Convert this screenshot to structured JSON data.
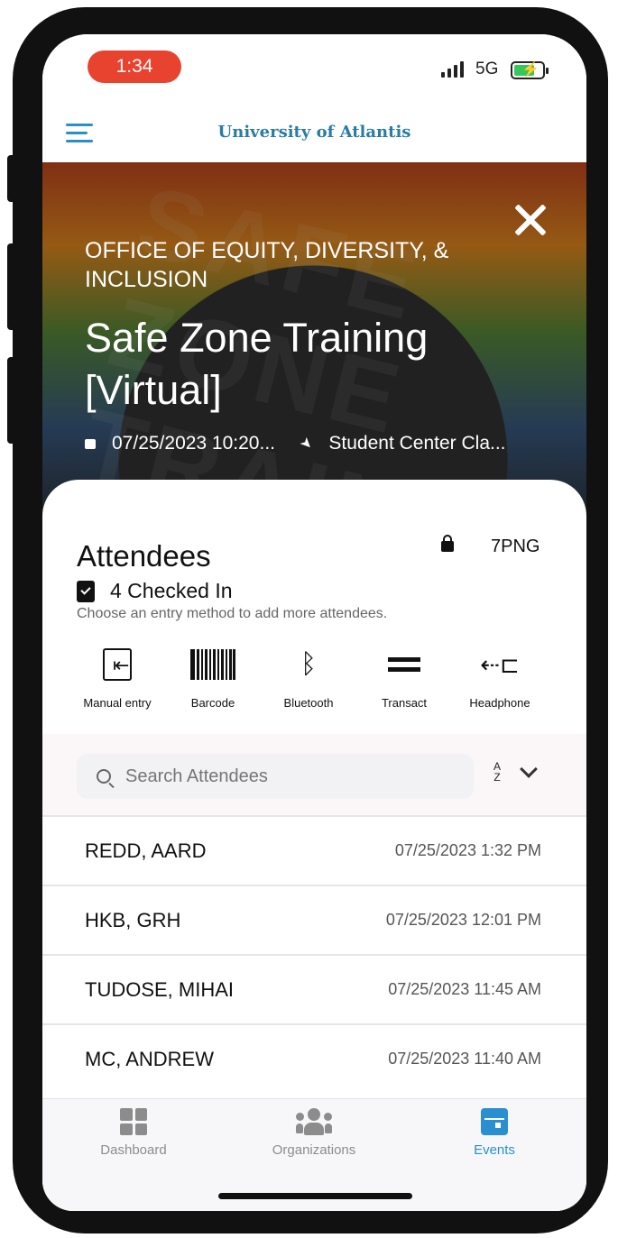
{
  "status_bar": {
    "time": "1:34",
    "network": "5G"
  },
  "header": {
    "brand": "University of Atlantis"
  },
  "event": {
    "organization": "OFFICE OF EQUITY, DIVERSITY, & INCLUSION",
    "title": "Safe Zone Training [Virtual]",
    "datetime": "07/25/2023 10:20...",
    "location": "Student Center Cla...",
    "watermark": "SAFE ZONE TRAINED"
  },
  "attendees": {
    "title": "Attendees",
    "code": "7PNG",
    "checked_in": "4 Checked In",
    "hint": "Choose an entry method to add more attendees.",
    "methods": [
      {
        "label": "Manual entry",
        "icon": "manual-entry-icon"
      },
      {
        "label": "Barcode",
        "icon": "barcode-icon"
      },
      {
        "label": "Bluetooth",
        "icon": "bluetooth-icon"
      },
      {
        "label": "Transact",
        "icon": "transact-icon"
      },
      {
        "label": "Headphone",
        "icon": "headphone-icon"
      }
    ],
    "search_placeholder": "Search Attendees",
    "sort_label": "A Z",
    "list": [
      {
        "name": "REDD, AARD",
        "time": "07/25/2023 1:32 PM"
      },
      {
        "name": "HKB, GRH",
        "time": "07/25/2023 12:01 PM"
      },
      {
        "name": "TUDOSE, MIHAI",
        "time": "07/25/2023 11:45 AM"
      },
      {
        "name": "MC, ANDREW",
        "time": "07/25/2023 11:40 AM"
      }
    ]
  },
  "tabs": [
    {
      "label": "Dashboard",
      "icon": "dashboard-icon",
      "active": false
    },
    {
      "label": "Organizations",
      "icon": "organizations-icon",
      "active": false
    },
    {
      "label": "Events",
      "icon": "events-icon",
      "active": true
    }
  ],
  "colors": {
    "accent": "#2a8fd0",
    "time_pill": "#e8432f",
    "battery": "#35c759",
    "inactive_tab": "#8c8c8c"
  }
}
